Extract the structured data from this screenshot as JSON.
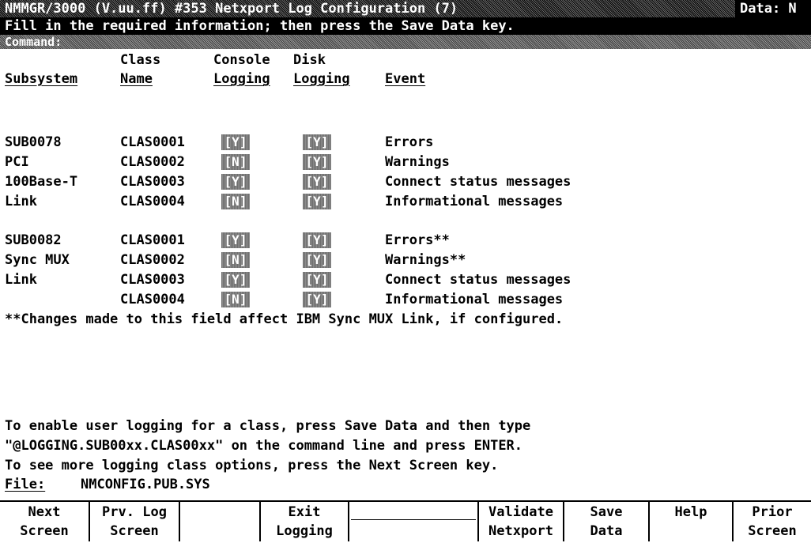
{
  "header": {
    "title": "NMMGR/3000 (V.uu.ff) #353 Netxport Log Configuration (7)",
    "data_flag": "Data: N",
    "instruction": "Fill in the required information; then press the Save Data key.",
    "command_label": "Command:"
  },
  "columns": {
    "subsystem": "Subsystem",
    "class_line1": "Class",
    "class_line2": "Name",
    "console_line1": "Console",
    "console_line2": "Logging",
    "disk_line1": "Disk",
    "disk_line2": "Logging",
    "event": "Event"
  },
  "group1": [
    {
      "subsystem": "SUB0078",
      "class": "CLAS0001",
      "console": "[Y]",
      "disk": "[Y]",
      "event": "Errors"
    },
    {
      "subsystem": "PCI",
      "class": "CLAS0002",
      "console": "[N]",
      "disk": "[Y]",
      "event": "Warnings"
    },
    {
      "subsystem": "100Base-T",
      "class": "CLAS0003",
      "console": "[Y]",
      "disk": "[Y]",
      "event": "Connect status messages"
    },
    {
      "subsystem": "Link",
      "class": "CLAS0004",
      "console": "[N]",
      "disk": "[Y]",
      "event": "Informational messages"
    }
  ],
  "group2": [
    {
      "subsystem": "SUB0082",
      "class": "CLAS0001",
      "console": "[Y]",
      "disk": "[Y]",
      "event": "Errors**"
    },
    {
      "subsystem": "Sync MUX",
      "class": "CLAS0002",
      "console": "[N]",
      "disk": "[Y]",
      "event": "Warnings**"
    },
    {
      "subsystem": "Link",
      "class": "CLAS0003",
      "console": "[Y]",
      "disk": "[Y]",
      "event": "Connect status messages"
    },
    {
      "subsystem": "",
      "class": "CLAS0004",
      "console": "[N]",
      "disk": "[Y]",
      "event": "Informational messages"
    }
  ],
  "footnote": "**Changes made to this field affect IBM Sync MUX Link, if configured.",
  "help": {
    "line1": "To enable user logging for a class, press Save Data and then type",
    "line2": "\"@LOGGING.SUB00xx.CLAS00xx\" on the command line and press ENTER.",
    "line3": "To see more logging class options, press the Next Screen key."
  },
  "file": {
    "label": "File:",
    "value": "NMCONFIG.PUB.SYS"
  },
  "function_keys": [
    {
      "line1": "Next",
      "line2": "Screen"
    },
    {
      "line1": "Prv. Log",
      "line2": "Screen"
    },
    {
      "line1": "",
      "line2": ""
    },
    {
      "line1": "Exit",
      "line2": "Logging"
    },
    {
      "line1": "",
      "line2": ""
    },
    {
      "line1": "Validate",
      "line2": "Netxport"
    },
    {
      "line1": "Save",
      "line2": "Data"
    },
    {
      "line1": "Help",
      "line2": ""
    },
    {
      "line1": "Prior",
      "line2": "Screen"
    }
  ]
}
